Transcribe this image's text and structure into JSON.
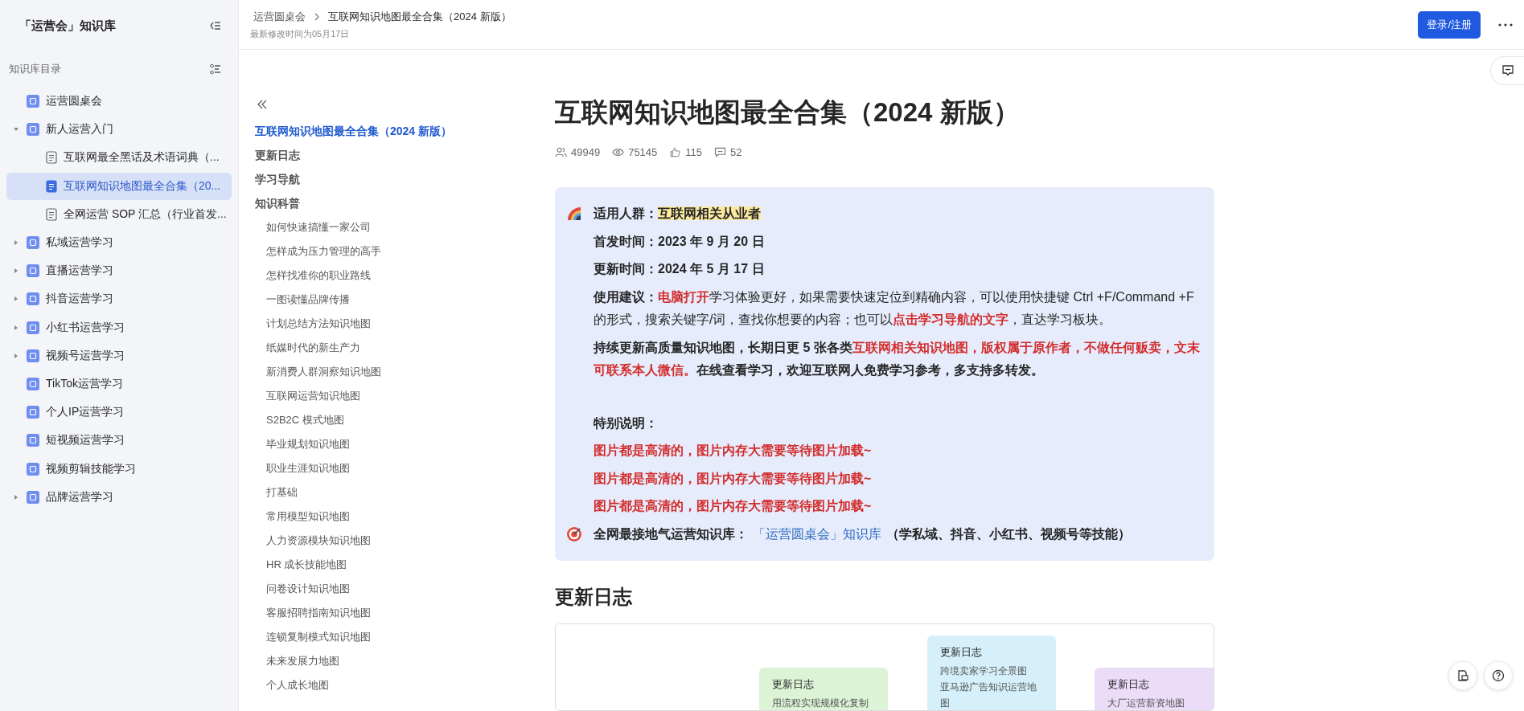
{
  "sidebar": {
    "title": "「运营会」知识库",
    "section_label": "知识库目录",
    "items": [
      {
        "label": "运营圆桌会",
        "selected": false
      },
      {
        "label": "新人运营入门",
        "selected": false,
        "expanded": true,
        "children": [
          {
            "label": "互联网最全黑话及术语词典（...",
            "selected": false
          },
          {
            "label": "互联网知识地图最全合集（20...",
            "selected": true
          },
          {
            "label": "全网运营 SOP 汇总（行业首发...",
            "selected": false
          }
        ]
      },
      {
        "label": "私域运营学习",
        "selected": false,
        "expanded": false
      },
      {
        "label": "直播运营学习",
        "selected": false,
        "expanded": false
      },
      {
        "label": "抖音运营学习",
        "selected": false,
        "expanded": false
      },
      {
        "label": "小红书运营学习",
        "selected": false,
        "expanded": false
      },
      {
        "label": "视频号运营学习",
        "selected": false,
        "expanded": false
      },
      {
        "label": "TikTok运营学习",
        "selected": false
      },
      {
        "label": "个人IP运营学习",
        "selected": false
      },
      {
        "label": "短视频运营学习",
        "selected": false
      },
      {
        "label": "视频剪辑技能学习",
        "selected": false
      },
      {
        "label": "品牌运营学习",
        "selected": false,
        "expanded": false
      }
    ]
  },
  "header": {
    "breadcrumb": [
      "运营圆桌会",
      "互联网知识地图最全合集（2024 新版）"
    ],
    "modified": "最新修改时间为05月17日",
    "login_button": "登录/注册"
  },
  "toc": [
    {
      "label": "互联网知识地图最全合集（2024 新版）",
      "selected": true
    },
    {
      "label": "更新日志",
      "selected": false
    },
    {
      "label": "学习导航",
      "selected": false
    },
    {
      "label": "知识科普",
      "selected": false,
      "children": [
        {
          "label": "如何快速搞懂一家公司",
          "selected": false
        },
        {
          "label": "怎样成为压力管理的高手",
          "selected": false
        },
        {
          "label": "怎样找准你的职业路线",
          "selected": false
        },
        {
          "label": "一图读懂品牌传播",
          "selected": false
        },
        {
          "label": "计划总结方法知识地图",
          "selected": false
        },
        {
          "label": "纸媒时代的新生产力",
          "selected": false
        },
        {
          "label": "新消费人群洞察知识地图",
          "selected": false
        },
        {
          "label": "互联网运营知识地图",
          "selected": false
        },
        {
          "label": "S2B2C 模式地图",
          "selected": false
        },
        {
          "label": "毕业规划知识地图",
          "selected": false
        },
        {
          "label": "职业生涯知识地图",
          "selected": false
        },
        {
          "label": "打基础",
          "selected": false
        },
        {
          "label": "常用模型知识地图",
          "selected": false
        },
        {
          "label": "人力资源模块知识地图",
          "selected": false
        },
        {
          "label": "HR 成长技能地图",
          "selected": false
        },
        {
          "label": "问卷设计知识地图",
          "selected": false
        },
        {
          "label": "客服招聘指南知识地图",
          "selected": false
        },
        {
          "label": "连锁复制模式知识地图",
          "selected": false
        },
        {
          "label": "未来发展力地图",
          "selected": false
        },
        {
          "label": "个人成长地图",
          "selected": false
        }
      ]
    }
  ],
  "article": {
    "title": "互联网知识地图最全合集（2024 新版）",
    "stats": {
      "members": "49949",
      "views": "75145",
      "likes": "115",
      "comments": "52"
    },
    "callout": [
      {
        "segments": [
          {
            "kind": "bold",
            "text": "适用人群："
          },
          {
            "kind": "highlight",
            "text": "互联网相关从业者"
          }
        ]
      },
      {
        "segments": [
          {
            "kind": "bold",
            "text": "首发时间：2023 年 9 月 20 日"
          }
        ]
      },
      {
        "segments": [
          {
            "kind": "bold",
            "text": "更新时间：2024 年 5 月 17 日"
          }
        ]
      },
      {
        "segments": [
          {
            "kind": "bold",
            "text": "使用建议："
          },
          {
            "kind": "red",
            "text": "电脑打开"
          },
          {
            "kind": "plain",
            "text": "学习体验更好，如果需要快速定位到精确内容，可以使用快捷键 Ctrl +F/Command +F 的形式，搜索关键字/词，查找你想要的内容；也可以"
          },
          {
            "kind": "red",
            "text": "点击学习导航的文字"
          },
          {
            "kind": "plain",
            "text": "，直达学习板块。"
          }
        ]
      },
      {
        "segments": [
          {
            "kind": "bold",
            "text": "持续更新高质量知识地图，长期日更 5 张各类"
          },
          {
            "kind": "red",
            "text": "互联网相关知识地图，版权属于原作者，不做任何贩卖，文末可联系本人微信。"
          },
          {
            "kind": "bold",
            "text": "在线查看学习，欢迎互联网人免费学习参考，多支持多转发。"
          }
        ]
      },
      {
        "segments": [
          {
            "kind": "bold",
            "text": "特别说明："
          }
        ]
      },
      {
        "segments": [
          {
            "kind": "red",
            "text": "图片都是高清的，图片内存大需要等待图片加载~"
          }
        ]
      },
      {
        "segments": [
          {
            "kind": "red",
            "text": "图片都是高清的，图片内存大需要等待图片加载~"
          }
        ]
      },
      {
        "segments": [
          {
            "kind": "red",
            "text": "图片都是高清的，图片内存大需要等待图片加载~"
          }
        ]
      },
      {
        "segments": [
          {
            "kind": "bold",
            "text": "全网最接地气运营知识库："
          },
          {
            "kind": "link",
            "text": "「运营圆桌会」知识库"
          },
          {
            "kind": "bold",
            "text": "（学私域、抖音、小红书、视频号等技能）"
          }
        ]
      }
    ],
    "section_heading": "更新日志",
    "mindmap_nodes": [
      {
        "title": "更新日志",
        "lines": [
          "用流程实现规模化复制"
        ],
        "color": "#dcf3d6"
      },
      {
        "title": "更新日志",
        "lines": [
          "跨境卖家学习全景图",
          "亚马逊广告知识运营地",
          "图"
        ],
        "color": "#d5f0fa"
      },
      {
        "title": "更新日志",
        "lines": [
          "大厂运营薪资地图"
        ],
        "color": "#ebdcf8"
      }
    ]
  }
}
